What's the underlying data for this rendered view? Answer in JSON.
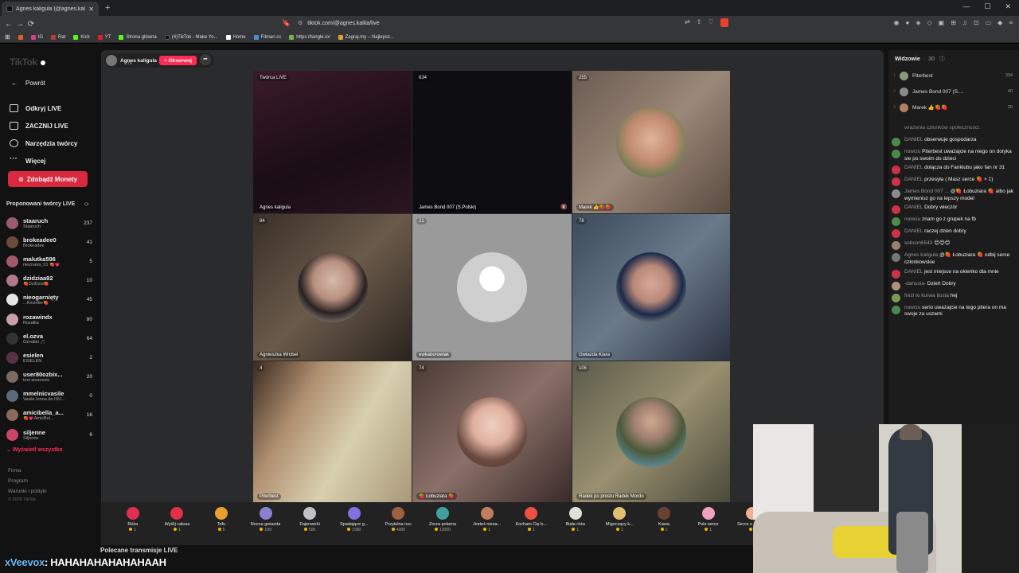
{
  "browser": {
    "tab_title": "Agnes kaligula (@agnes.kal...",
    "url": "tiktok.com/@agnes.kalita/live",
    "bookmarks": [
      "IG",
      "Rat",
      "Kick",
      "YT",
      "Strona główna",
      "(4)TikTok - Make Yo...",
      "Home",
      "Filman.cc",
      "https://tangle.io/",
      "Zagraj.my – Najlepsz..."
    ]
  },
  "sidebar": {
    "back": "Powrót",
    "nav": [
      "Odkryj LIVE",
      "ZACZNIJ LIVE",
      "Narzędzia twórcy",
      "Więcej"
    ],
    "coins_btn": "Zdobądź Monety",
    "rec_title": "Proponowani twórcy LIVE",
    "creators": [
      {
        "name": "staaruch",
        "sub": "Staaruch",
        "count": "237",
        "color": "#9b5c6f"
      },
      {
        "name": "brokeadee0",
        "sub": "Brokeadee",
        "count": "41",
        "color": "#6b4a3a"
      },
      {
        "name": "malutka596",
        "sub": "nieznana_01 🍓💗",
        "count": "5",
        "color": "#a05a6a"
      },
      {
        "name": "dzidziaa92",
        "sub": "🍓DziDzia🍓",
        "count": "10",
        "color": "#b0788a"
      },
      {
        "name": "nieogarnięty",
        "sub": "...Kristofer🍓",
        "count": "45",
        "color": "#e6e6e6"
      },
      {
        "name": "rozawindx",
        "sub": "Rozalka",
        "count": "80",
        "color": "#c9a0a8"
      },
      {
        "name": "el.ozva",
        "sub": "Ozvaldo 🎵",
        "count": "64",
        "color": "#333333"
      },
      {
        "name": "esielen",
        "sub": "ESIELEN",
        "count": "2",
        "color": "#553344"
      },
      {
        "name": "user80ozbix...",
        "sub": "toni sinanovic",
        "count": "20",
        "color": "#7a6a60"
      },
      {
        "name": "mmelnicvasile",
        "sub": "Vasile Ionna de ISU...",
        "count": "0",
        "color": "#5a6a7a"
      },
      {
        "name": "amicibella_a...",
        "sub": "🍓💗AmicBel...",
        "count": "16",
        "color": "#8a6a5a"
      },
      {
        "name": "siljenne",
        "sub": "Siljenne",
        "count": "6",
        "color": "#cc4466"
      }
    ],
    "show_all": "Wyświetl wszystko",
    "footer": [
      "Firma",
      "Program",
      "Warunki i polityki"
    ],
    "copyright": "© 2026 TikTok"
  },
  "host": {
    "name": "Agnes kaligula",
    "likes": "3,7K",
    "follow": "+ Obserwuj"
  },
  "grid": [
    {
      "badge": "Twórca LIVE",
      "label": "Agnes kaligula",
      "bg": "linear-gradient(160deg,#3a1a2a 0%,#1a0d14 60%,#2a1520 100%)",
      "avatar": ""
    },
    {
      "badge": "634",
      "label": "James Bond 007 (S.Polski)",
      "bg": "#0d0d12",
      "avatar": ""
    },
    {
      "badge": "255",
      "label": "Marek 👍🍓🍓",
      "bg": "linear-gradient(135deg,#6a5a50,#9a8878,#5a4a40)",
      "avatar": "radial-gradient(circle at 50% 45%,#e0b49a 0%,#c08a70 45%,#6a7a50 75%,#3a4a2a 100%)"
    },
    {
      "badge": "84",
      "label": "Agnieszka Wrobel",
      "bg": "linear-gradient(135deg,#3a3028,#6a5a4a,#2a241e)",
      "avatar": "radial-gradient(circle at 50% 40%,#d8b8a8 0%,#b89080 35%,#2a2220 60%,#c8c0b8 100%)"
    },
    {
      "badge": "21",
      "label": "ewkaborowiak",
      "bg": "#9a9a9a",
      "avatar": "radial-gradient(circle at 50% 38%,#ffffff 0%,#ffffff 22%,#cfcfcf 23%,#cfcfcf 100%)"
    },
    {
      "badge": "78",
      "label": "Gwiazda Klara",
      "bg": "linear-gradient(135deg,#3a4a5a,#6a7a8a,#2a3040)",
      "avatar": "radial-gradient(circle at 50% 45%,#d8a898 0%,#b88878 35%,#1a2a4a 60%,#e8d8a8 100%)"
    },
    {
      "badge": "4",
      "label": "Piterbest",
      "bg": "linear-gradient(120deg,#3a2a20 0%,#b09070 30%,#d8d0b0 60%,#a89878 100%)",
      "avatar": ""
    },
    {
      "badge": "74",
      "label": "🍓 Łobuziara 🍓",
      "bg": "linear-gradient(135deg,#4a3a35,#8a7068,#3a2a28)",
      "avatar": "radial-gradient(circle at 50% 40%,#f0d0c0 0%,#e0b0a0 35%,#6a4a40 65%,#5a3a30 100%)"
    },
    {
      "badge": "106",
      "label": "Radek po prostu Radek Mordo",
      "bg": "linear-gradient(135deg,#5a5a4a,#9a9070,#4a4a3a)",
      "avatar": "radial-gradient(circle at 50% 35%,#d0a890 0%,#a08070 30%,#4a5a3a 55%,#6ab0e0 100%)"
    }
  ],
  "gifts": [
    {
      "name": "Róża",
      "price": "1",
      "color": "#e03050"
    },
    {
      "name": "Wyślij całusa",
      "price": "1",
      "color": "#e0304a"
    },
    {
      "name": "Tofu",
      "price": "5",
      "color": "#e8a030"
    },
    {
      "name": "Nocna gwiazda",
      "price": "199",
      "color": "#8a80d0"
    },
    {
      "name": "Fajerwerki",
      "price": "500",
      "color": "#c0c0c8"
    },
    {
      "name": "Spadające g...",
      "price": "1580",
      "color": "#8070e0"
    },
    {
      "name": "Przytulna noc",
      "price": "4000",
      "color": "#a06040"
    },
    {
      "name": "Zorza polarna",
      "price": "12000",
      "color": "#40a0a0"
    },
    {
      "name": "Jesteś niesa...",
      "price": "1",
      "color": "#c08060"
    },
    {
      "name": "Kocham Cię b...",
      "price": "1",
      "color": "#f05040"
    },
    {
      "name": "Biała róża",
      "price": "1",
      "color": "#e0e0d8"
    },
    {
      "name": "Migoczący k...",
      "price": "1",
      "color": "#e0c070"
    },
    {
      "name": "Kawa",
      "price": "1",
      "color": "#6a4030"
    },
    {
      "name": "Puls-serce",
      "price": "1",
      "color": "#f0a0c0"
    },
    {
      "name": "Serce z palcó...",
      "price": "5",
      "color": "#f0b090"
    }
  ],
  "recommended": "Polecane transmisje LIVE",
  "chat": {
    "viewers_title": "Widzowie",
    "viewers_count": "30",
    "top": [
      {
        "rank": "1",
        "name": "Piterbest",
        "score": "334",
        "color": "#8a9a7a"
      },
      {
        "rank": "2",
        "name": "James Bond 007 (S....",
        "score": "40",
        "color": "#8a8a8a"
      },
      {
        "rank": "3",
        "name": "Marek 👍🍓🍓",
        "score": "20",
        "color": "#b08060"
      }
    ],
    "messages": [
      {
        "user": "",
        "text": "wrażenia członków społeczności.",
        "color": ""
      },
      {
        "user": "DANIEL",
        "text": "obserwuje gospodarza",
        "color": "#4a8a4a"
      },
      {
        "user": "nowciu",
        "text": "Piterbest uważajcie na niego on dotyka sie po swoim do dzieci",
        "color": "#4a8a4a"
      },
      {
        "user": "DANIEL",
        "text": "dołącza do Fanklubu jako fan nr 31",
        "color": "#cc3344"
      },
      {
        "user": "DANIEL",
        "text": "przesyła ( Masz serce 🍓 × 1)",
        "color": "#cc3344"
      },
      {
        "user": "James Bond 007 ...",
        "text": "@🍓 Łobuziara 🍓 albo jak wymienisz go na lepszy model",
        "color": "#8a8a8a"
      },
      {
        "user": "DANIEL",
        "text": "Dobry wieczór",
        "color": "#cc3344"
      },
      {
        "user": "nowciu",
        "text": "znam go z grupek na fb",
        "color": "#4a8a4a"
      },
      {
        "user": "DANIEL",
        "text": "raczej dzien dobry",
        "color": "#cc3344"
      },
      {
        "user": "sobson6543",
        "text": "😊😊😊",
        "color": "#9a8070"
      },
      {
        "user": "Agnes kaligula",
        "text": "@🍓 Łobuziara 🍓 odbij serce członkowskie",
        "color": "#777777"
      },
      {
        "user": "DANIEL",
        "text": "jest miejsce na okienko dla mnie",
        "color": "#cc3344"
      },
      {
        "user": "-danusia-",
        "text": "Dzień Dobry",
        "color": "#b09080"
      },
      {
        "user": "frezi to kurwa tłusta",
        "text": "hej",
        "color": "#7a9a5a"
      },
      {
        "user": "nowciu",
        "text": "serio uważajcie na tego pitera on ma swoje za uszami",
        "color": "#4a8a4a"
      }
    ]
  },
  "overlay": {
    "name": "xVeevox",
    "text": ": HAHAHAHAHAHAHAAH"
  }
}
